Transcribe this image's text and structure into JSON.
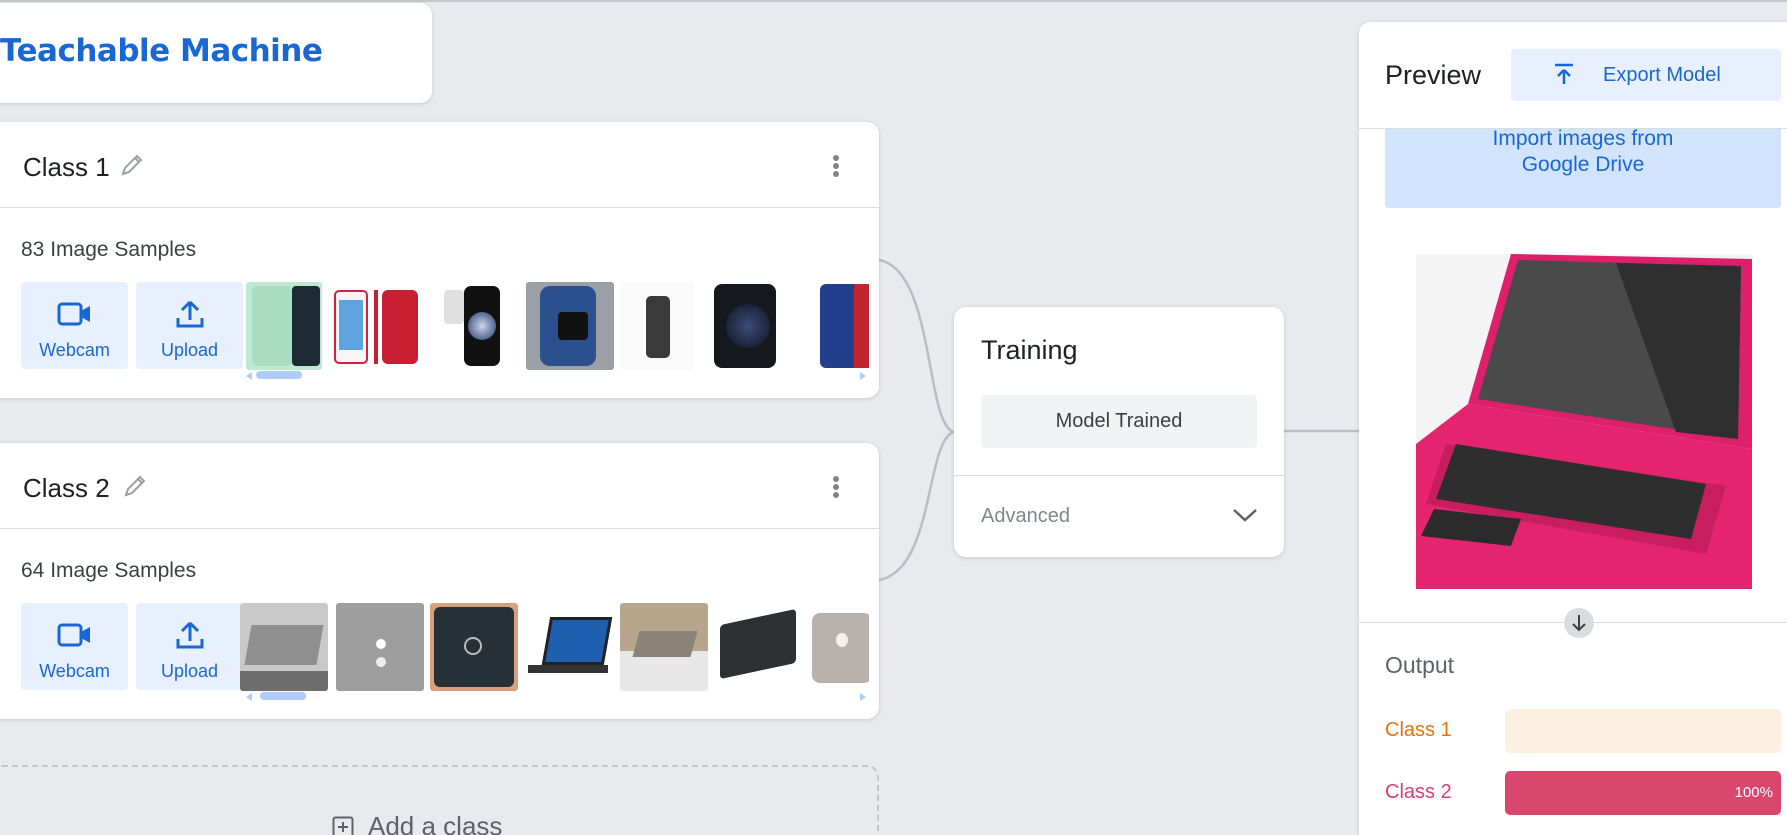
{
  "app": {
    "title": "Teachable Machine"
  },
  "classes": [
    {
      "name": "Class 1",
      "samples_label": "83 Image Samples",
      "webcam_label": "Webcam",
      "upload_label": "Upload",
      "thumbnails": [
        "green phone",
        "red phone",
        "white phone",
        "blue phone",
        "graphite phone",
        "black phone",
        "blue phone"
      ],
      "scroll_fraction": 0.0
    },
    {
      "name": "Class 2",
      "samples_label": "64 Image Samples",
      "webcam_label": "Webcam",
      "upload_label": "Upload",
      "thumbnails": [
        "silver laptop",
        "grey laptop",
        "dark laptop",
        "open laptop",
        "laptop on table",
        "black laptop",
        "silver laptop"
      ],
      "scroll_fraction": 0.0
    }
  ],
  "add_class": {
    "label": "Add a class",
    "icon": "plus-box-icon"
  },
  "training": {
    "title": "Training",
    "button_label": "Model Trained",
    "advanced_label": "Advanced",
    "advanced_icon": "chevron-down-icon"
  },
  "preview": {
    "title": "Preview",
    "export_label": "Export Model",
    "export_icon": "upload-arrow-icon",
    "drive_line1": "Import images from",
    "drive_line2": "Google Drive",
    "output_title": "Output",
    "outputs": [
      {
        "label": "Class 1",
        "value": 0,
        "percent_label": "",
        "color": "#e8710a",
        "bar_bg": "#feefe3"
      },
      {
        "label": "Class 2",
        "value": 1.0,
        "percent_label": "100%",
        "color": "#d93f6c",
        "bar_bg": "#fce8ee"
      }
    ]
  },
  "colors": {
    "accent": "#1967d2",
    "light_accent": "#e8f0fe"
  }
}
